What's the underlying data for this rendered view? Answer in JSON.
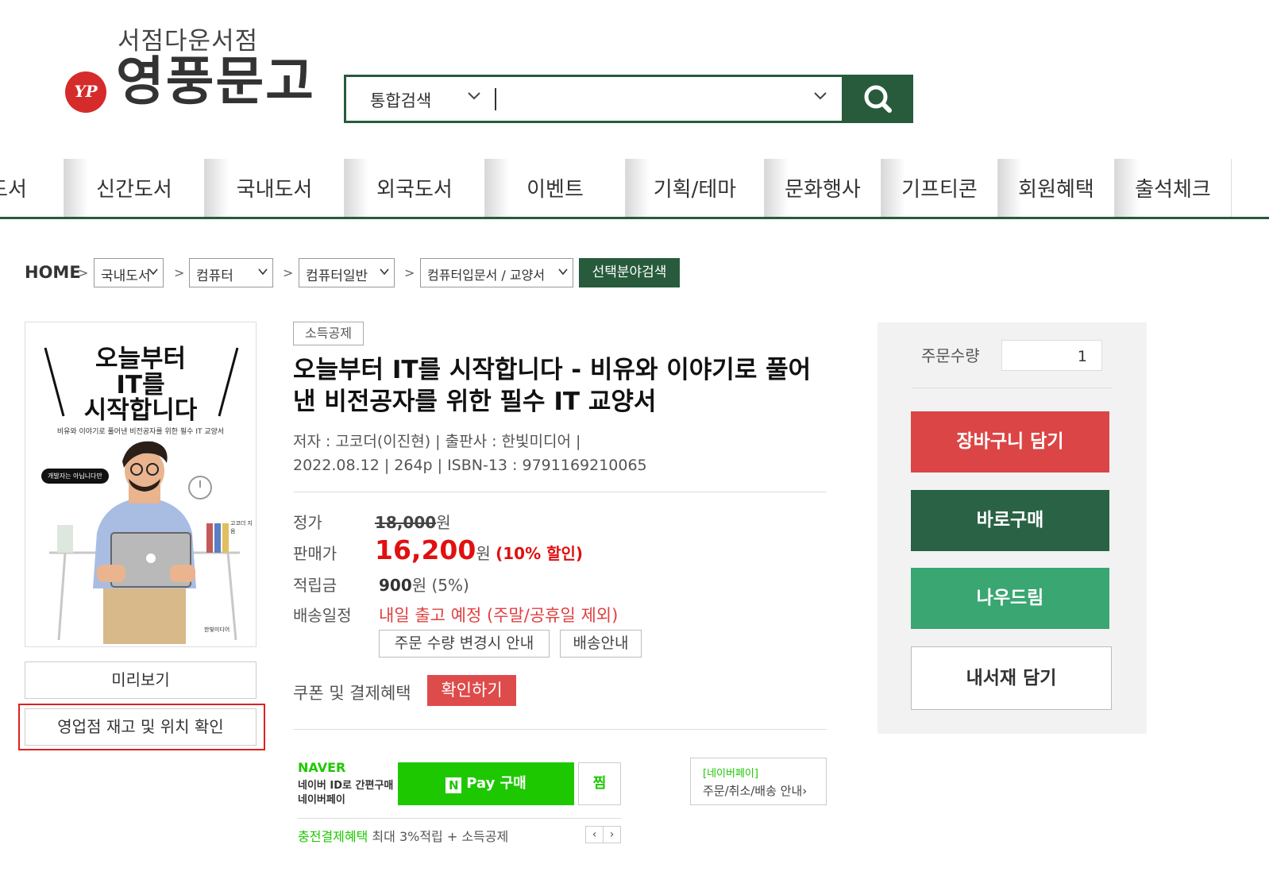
{
  "header": {
    "tagline": "서점다운서점",
    "logo_text": "영풍문고",
    "logo_emblem": "YP",
    "search_category": "통합검색",
    "search_placeholder": ""
  },
  "nav": {
    "items": [
      "도서",
      "신간도서",
      "국내도서",
      "외국도서",
      "이벤트",
      "기획/테마",
      "문화행사",
      "기프티콘",
      "회원혜택",
      "출석체크"
    ]
  },
  "breadcrumb": {
    "home": "HOME",
    "sep": ">",
    "level1": "국내도서",
    "level2": "컴퓨터",
    "level3": "컴퓨터일반",
    "level4": "컴퓨터입문서 / 교양서",
    "search_button": "선택분야검색"
  },
  "cover": {
    "title_lines": [
      "오늘부터",
      "IT를",
      "시작합니다"
    ],
    "subtitle": "비유와 이야기로 풀어낸 비전공자를 위한 필수 IT 교양서",
    "bubble": "개발자는 아닙니다만",
    "author": "고코더 지음",
    "publisher": "한빛미디어",
    "preview_button": "미리보기",
    "stock_button": "영업점 재고 및 위치 확인"
  },
  "product": {
    "badge": "소득공제",
    "title": "오늘부터 IT를 시작합니다 - 비유와 이야기로 풀어낸 비전공자를 위한 필수 IT 교양서",
    "meta_line1": "저자 : 고코더(이진현)  |  출판사 : 한빛미디어  |",
    "meta_line2": "2022.08.12  |  264p  |  ISBN-13 : 9791169210065",
    "price_label": "정가",
    "price_value": "18,000",
    "won": "원",
    "sale_label": "판매가",
    "sale_value": "16,200",
    "discount": "(10% 할인)",
    "point_label": "적립금",
    "point_value": "900",
    "point_rate": "원 (5%)",
    "shipping_label": "배송일정",
    "shipping_value": "내일 출고 예정   (주말/공휴일 제외)",
    "qty_notice_button": "주문 수량 변경시 안내",
    "shipping_info_button": "배송안내",
    "coupon_label": "쿠폰 및 결제혜택",
    "coupon_button": "확인하기"
  },
  "naverpay": {
    "brand": "NAVER",
    "desc1": "네이버 ID로 간편구매",
    "desc2": "네이버페이",
    "pay_button_n": "N",
    "pay_button": "Pay 구매",
    "wish_button": "찜",
    "benefit_green": "충전결제혜택",
    "benefit_text": " 최대 3%적립 + 소득공제",
    "pager_prev": "‹",
    "pager_next": "›",
    "info_title": "[네이버페이]",
    "info_text": "주문/취소/배송 안내›"
  },
  "order": {
    "qty_label": "주문수량",
    "qty_value": "1",
    "cart_button": "장바구니 담기",
    "buy_button": "바로구매",
    "gift_button": "나우드림",
    "shelf_button": "내서재 담기"
  },
  "colors": {
    "brand_green": "#275b3c",
    "cart_red": "#dc4545",
    "buy_green": "#2a6246",
    "gift_green": "#3aa671",
    "price_red": "#e01010",
    "naver_green": "#1ec800"
  }
}
